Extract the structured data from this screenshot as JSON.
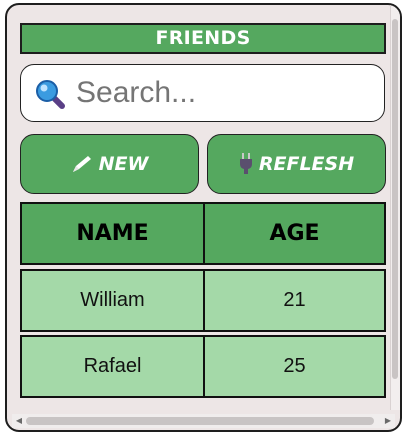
{
  "header": {
    "title": "FRIENDS"
  },
  "search": {
    "placeholder": "Search..."
  },
  "toolbar": {
    "new_label": "NEW",
    "refresh_label": "REFLESH",
    "new_icon": "pencil-icon",
    "refresh_icon": "plug-icon"
  },
  "table": {
    "columns": [
      "NAME",
      "AGE"
    ],
    "rows": [
      {
        "name": "William",
        "age": "21"
      },
      {
        "name": "Rafael",
        "age": "25"
      }
    ]
  },
  "colors": {
    "accent_green": "#55a85f",
    "row_green": "#a4d9a8",
    "panel_bg": "#ede6e6"
  }
}
